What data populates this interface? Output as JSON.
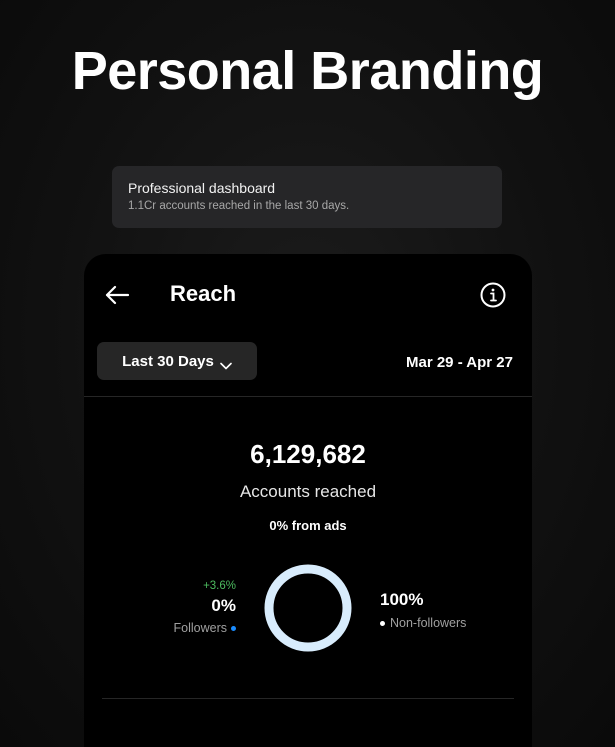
{
  "headline": "Personal Branding",
  "notification": {
    "title": "Professional dashboard",
    "subtitle": "1.1Cr accounts reached in the last 30 days."
  },
  "header": {
    "back_icon": "arrow-left-icon",
    "title": "Reach",
    "info_icon": "info-icon"
  },
  "filter": {
    "selected_range": "Last 30 Days",
    "dropdown_icon": "chevron-down-icon",
    "date_range": "Mar 29 - Apr 27"
  },
  "summary": {
    "accounts_reached": "6,129,682",
    "accounts_label": "Accounts reached",
    "from_ads": "0% from ads"
  },
  "breakdown": {
    "followers_growth": "+3.6%",
    "followers_pct": "0%",
    "followers_label": "Followers",
    "followers_color": "#1a8cff",
    "non_followers_pct": "100%",
    "non_followers_label": "Non-followers",
    "non_followers_color": "#d8ecfc",
    "non_followers_share": 1.0,
    "followers_share": 0.0
  },
  "colors": {
    "background": "#111111",
    "card": "#262628",
    "growth": "#4cbb5f"
  }
}
